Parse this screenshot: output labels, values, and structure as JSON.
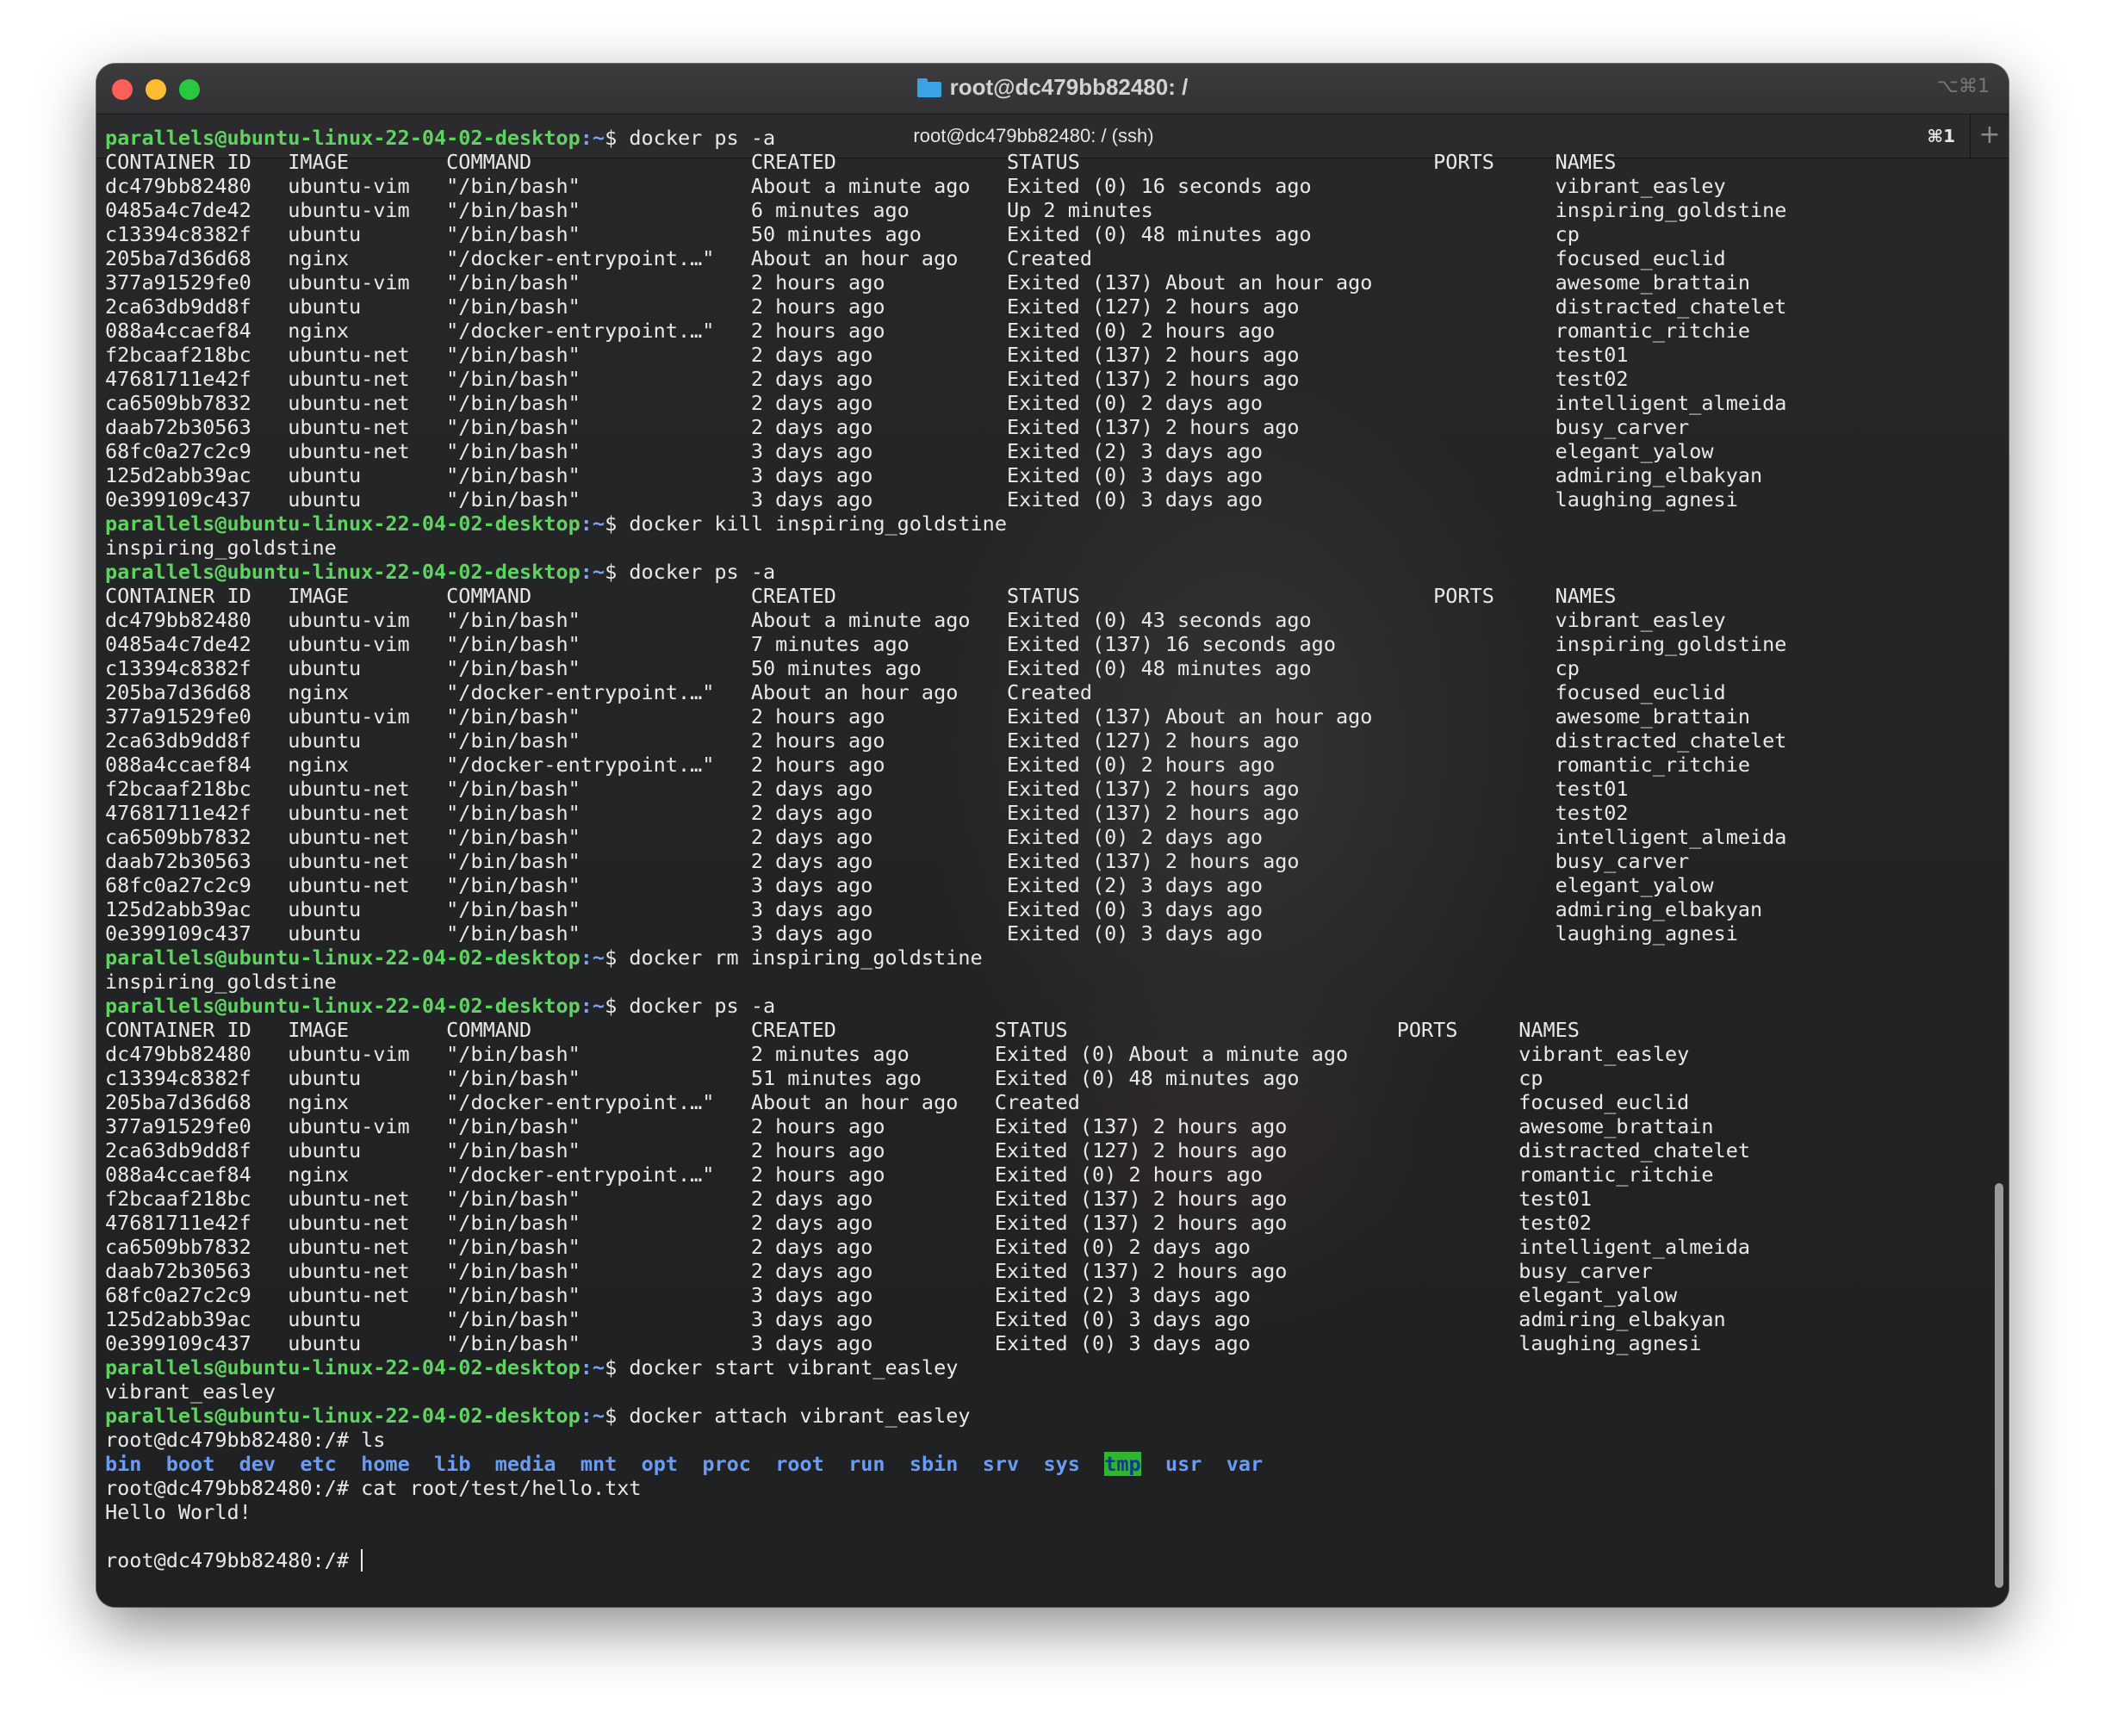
{
  "window": {
    "title": "root@dc479bb82480: /",
    "shortcut": "⌥⌘1",
    "tab_label": "root@dc479bb82480: / (ssh)",
    "tab_shortcut": "⌘1",
    "new_tab_symbol": "+"
  },
  "prompt": {
    "user_host": "parallels@ubuntu-linux-22-04-02-desktop",
    "path": ":~",
    "sign": "$ "
  },
  "terminal": {
    "block1_cmd": "docker ps -a",
    "block1": [
      "CONTAINER ID   IMAGE        COMMAND                  CREATED              STATUS                             PORTS     NAMES",
      "dc479bb82480   ubuntu-vim   \"/bin/bash\"              About a minute ago   Exited (0) 16 seconds ago                    vibrant_easley",
      "0485a4c7de42   ubuntu-vim   \"/bin/bash\"              6 minutes ago        Up 2 minutes                                 inspiring_goldstine",
      "c13394c8382f   ubuntu       \"/bin/bash\"              50 minutes ago       Exited (0) 48 minutes ago                    cp",
      "205ba7d36d68   nginx        \"/docker-entrypoint.…\"   About an hour ago    Created                                      focused_euclid",
      "377a91529fe0   ubuntu-vim   \"/bin/bash\"              2 hours ago          Exited (137) About an hour ago               awesome_brattain",
      "2ca63db9dd8f   ubuntu       \"/bin/bash\"              2 hours ago          Exited (127) 2 hours ago                     distracted_chatelet",
      "088a4ccaef84   nginx        \"/docker-entrypoint.…\"   2 hours ago          Exited (0) 2 hours ago                       romantic_ritchie",
      "f2bcaaf218bc   ubuntu-net   \"/bin/bash\"              2 days ago           Exited (137) 2 hours ago                     test01",
      "47681711e42f   ubuntu-net   \"/bin/bash\"              2 days ago           Exited (137) 2 hours ago                     test02",
      "ca6509bb7832   ubuntu-net   \"/bin/bash\"              2 days ago           Exited (0) 2 days ago                        intelligent_almeida",
      "daab72b30563   ubuntu-net   \"/bin/bash\"              2 days ago           Exited (137) 2 hours ago                     busy_carver",
      "68fc0a27c2c9   ubuntu-net   \"/bin/bash\"              3 days ago           Exited (2) 3 days ago                        elegant_yalow",
      "125d2abb39ac   ubuntu       \"/bin/bash\"              3 days ago           Exited (0) 3 days ago                        admiring_elbakyan",
      "0e399109c437   ubuntu       \"/bin/bash\"              3 days ago           Exited (0) 3 days ago                        laughing_agnesi"
    ],
    "kill_cmd": "docker kill inspiring_goldstine",
    "kill_out": "inspiring_goldstine",
    "block2_cmd": "docker ps -a",
    "block2": [
      "CONTAINER ID   IMAGE        COMMAND                  CREATED              STATUS                             PORTS     NAMES",
      "dc479bb82480   ubuntu-vim   \"/bin/bash\"              About a minute ago   Exited (0) 43 seconds ago                    vibrant_easley",
      "0485a4c7de42   ubuntu-vim   \"/bin/bash\"              7 minutes ago        Exited (137) 16 seconds ago                  inspiring_goldstine",
      "c13394c8382f   ubuntu       \"/bin/bash\"              50 minutes ago       Exited (0) 48 minutes ago                    cp",
      "205ba7d36d68   nginx        \"/docker-entrypoint.…\"   About an hour ago    Created                                      focused_euclid",
      "377a91529fe0   ubuntu-vim   \"/bin/bash\"              2 hours ago          Exited (137) About an hour ago               awesome_brattain",
      "2ca63db9dd8f   ubuntu       \"/bin/bash\"              2 hours ago          Exited (127) 2 hours ago                     distracted_chatelet",
      "088a4ccaef84   nginx        \"/docker-entrypoint.…\"   2 hours ago          Exited (0) 2 hours ago                       romantic_ritchie",
      "f2bcaaf218bc   ubuntu-net   \"/bin/bash\"              2 days ago           Exited (137) 2 hours ago                     test01",
      "47681711e42f   ubuntu-net   \"/bin/bash\"              2 days ago           Exited (137) 2 hours ago                     test02",
      "ca6509bb7832   ubuntu-net   \"/bin/bash\"              2 days ago           Exited (0) 2 days ago                        intelligent_almeida",
      "daab72b30563   ubuntu-net   \"/bin/bash\"              2 days ago           Exited (137) 2 hours ago                     busy_carver",
      "68fc0a27c2c9   ubuntu-net   \"/bin/bash\"              3 days ago           Exited (2) 3 days ago                        elegant_yalow",
      "125d2abb39ac   ubuntu       \"/bin/bash\"              3 days ago           Exited (0) 3 days ago                        admiring_elbakyan",
      "0e399109c437   ubuntu       \"/bin/bash\"              3 days ago           Exited (0) 3 days ago                        laughing_agnesi"
    ],
    "rm_cmd": "docker rm inspiring_goldstine",
    "rm_out": "inspiring_goldstine",
    "block3_cmd": "docker ps -a",
    "block3": [
      "CONTAINER ID   IMAGE        COMMAND                  CREATED             STATUS                           PORTS     NAMES",
      "dc479bb82480   ubuntu-vim   \"/bin/bash\"              2 minutes ago       Exited (0) About a minute ago              vibrant_easley",
      "c13394c8382f   ubuntu       \"/bin/bash\"              51 minutes ago      Exited (0) 48 minutes ago                  cp",
      "205ba7d36d68   nginx        \"/docker-entrypoint.…\"   About an hour ago   Created                                    focused_euclid",
      "377a91529fe0   ubuntu-vim   \"/bin/bash\"              2 hours ago         Exited (137) 2 hours ago                   awesome_brattain",
      "2ca63db9dd8f   ubuntu       \"/bin/bash\"              2 hours ago         Exited (127) 2 hours ago                   distracted_chatelet",
      "088a4ccaef84   nginx        \"/docker-entrypoint.…\"   2 hours ago         Exited (0) 2 hours ago                     romantic_ritchie",
      "f2bcaaf218bc   ubuntu-net   \"/bin/bash\"              2 days ago          Exited (137) 2 hours ago                   test01",
      "47681711e42f   ubuntu-net   \"/bin/bash\"              2 days ago          Exited (137) 2 hours ago                   test02",
      "ca6509bb7832   ubuntu-net   \"/bin/bash\"              2 days ago          Exited (0) 2 days ago                      intelligent_almeida",
      "daab72b30563   ubuntu-net   \"/bin/bash\"              2 days ago          Exited (137) 2 hours ago                   busy_carver",
      "68fc0a27c2c9   ubuntu-net   \"/bin/bash\"              3 days ago          Exited (2) 3 days ago                      elegant_yalow",
      "125d2abb39ac   ubuntu       \"/bin/bash\"              3 days ago          Exited (0) 3 days ago                      admiring_elbakyan",
      "0e399109c437   ubuntu       \"/bin/bash\"              3 days ago          Exited (0) 3 days ago                      laughing_agnesi"
    ],
    "start_cmd": "docker start vibrant_easley",
    "start_out": "vibrant_easley",
    "attach_cmd": "docker attach vibrant_easley",
    "root_prompt": "root@dc479bb82480:/# ",
    "ls_cmd": "ls",
    "ls_dirs": [
      "bin",
      "boot",
      "dev",
      "etc",
      "home",
      "lib",
      "media",
      "mnt",
      "opt",
      "proc",
      "root",
      "run",
      "sbin",
      "srv",
      "sys",
      "tmp",
      "usr",
      "var"
    ],
    "ls_highlight": "tmp",
    "cat_cmd": "cat root/test/hello.txt",
    "cat_out": "Hello World!"
  }
}
